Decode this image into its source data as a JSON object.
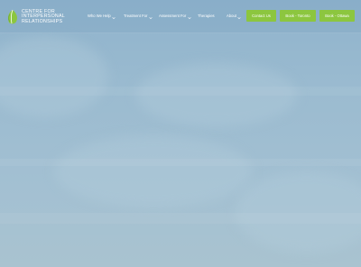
{
  "brand": {
    "line1": "CENTRE FOR",
    "line2": "INTERPERSONAL",
    "line3": "RELATIONSHIPS"
  },
  "nav": {
    "items": [
      {
        "label": "Who We Help",
        "has_dropdown": true
      },
      {
        "label": "Treatment For",
        "has_dropdown": true
      },
      {
        "label": "Assessment For",
        "has_dropdown": true
      },
      {
        "label": "Therapies",
        "has_dropdown": false
      },
      {
        "label": "About",
        "has_dropdown": true
      }
    ]
  },
  "cta": {
    "contact": "Contact Us",
    "book_toronto": "Book - Toronto",
    "book_ottawa": "Book - Ottawa"
  },
  "colors": {
    "accent": "#8cc63f",
    "nav_text": "#ffffff",
    "logo_green": "#8cc63f"
  }
}
